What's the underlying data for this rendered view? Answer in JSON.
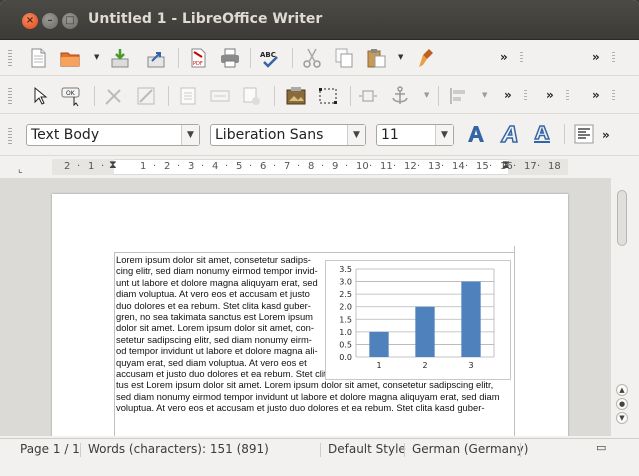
{
  "window": {
    "title": "Untitled 1 - LibreOffice Writer"
  },
  "toolbar_standard": {
    "icons": [
      "new-document-icon",
      "open-folder-icon",
      "save-icon",
      "export-icon",
      "export-pdf-icon",
      "print-icon",
      "spellcheck-icon",
      "cut-icon",
      "copy-icon",
      "paste-icon",
      "clone-formatting-icon"
    ],
    "spellcheck_label": "ABC",
    "pdf_label": "PDF",
    "overflow": "»"
  },
  "toolbar_drawing": {
    "icons": [
      "select-arrow-icon",
      "form-button-icon",
      "design-mode-icon",
      "form-wizard-icon",
      "form-navigator-icon",
      "form-field-icon",
      "form-check-icon",
      "insert-image-icon",
      "frame-icon",
      "wrap-icon",
      "anchor-icon",
      "align-icon"
    ],
    "button_label": "OK",
    "overflow": "»"
  },
  "toolbar_formatting": {
    "paragraph_style": "Text Body",
    "font_name": "Liberation Sans",
    "font_size": "11",
    "overflow": "»"
  },
  "ruler": {
    "numbers": [
      "2",
      "1",
      "1",
      "2",
      "3",
      "4",
      "5",
      "6",
      "7",
      "8",
      "9",
      "10",
      "11",
      "12",
      "13",
      "14",
      "15",
      "16",
      "17",
      "18"
    ]
  },
  "document": {
    "narrow_lines": [
      "Lorem ipsum dolor sit amet, consetetur sadips-",
      "cing elitr, sed diam nonumy eirmod tempor invid-",
      "unt ut labore et dolore magna aliquyam erat, sed",
      "diam voluptua. At vero eos et accusam et justo",
      "duo dolores et ea rebum. Stet clita kasd guber-",
      "gren, no sea takimata sanctus est Lorem ipsum",
      "dolor sit amet. Lorem ipsum dolor sit amet, con-",
      "setetur sadipscing elitr, sed diam nonumy eirm-",
      "od tempor invidunt ut labore et dolore magna ali-",
      "quyam erat, sed diam voluptua. At vero eos et"
    ],
    "full_lines": [
      "accusam et justo duo dolores et ea rebum. Stet clita kasd gubergren, no sea takimata sanc-",
      "tus est Lorem ipsum dolor sit amet. Lorem ipsum dolor sit amet, consetetur sadipscing elitr,",
      "sed diam nonumy eirmod tempor invidunt ut labore et dolore magna aliquyam erat, sed diam",
      "voluptua. At vero eos et accusam et justo duo dolores et ea rebum. Stet clita kasd guber-"
    ]
  },
  "chart_data": {
    "type": "bar",
    "categories": [
      "1",
      "2",
      "3"
    ],
    "values": [
      1,
      2,
      3
    ],
    "ylim": [
      0,
      3.5
    ],
    "yticks": [
      "0.0",
      "0.5",
      "1.0",
      "1.5",
      "2.0",
      "2.5",
      "3.0",
      "3.5"
    ],
    "grid": true,
    "bar_color": "#4f81bd"
  },
  "statusbar": {
    "page": "Page 1 / 1",
    "words": "Words (characters): 151 (891)",
    "style": "Default Style",
    "language": "German (Germany)"
  },
  "colors": {
    "titlebar": "#3c3b37",
    "close_button": "#df4a16",
    "accent_blue": "#3465a4"
  }
}
